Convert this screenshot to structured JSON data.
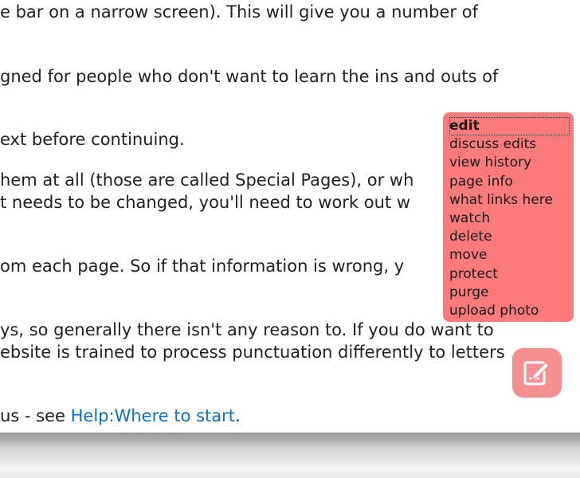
{
  "article": {
    "lines": [
      "e bar on a narrow screen). This will give you a number of",
      "gned for people who don't want to learn the ins and outs of",
      "ext before continuing.",
      "hem at all (those are called Special Pages), or wh",
      "t needs to be changed, you'll need to work out w",
      "om each page. So if that information is wrong, y",
      "ys, so generally there isn't any reason to. If you do want to",
      "ebsite is trained to process punctuation differently to letters",
      "us - see "
    ],
    "link_text": "Help:Where to start",
    "after_link": "."
  },
  "menu": {
    "items": [
      "edit",
      "discuss edits",
      "view history",
      "page info",
      "what links here",
      "watch",
      "delete",
      "move",
      "protect",
      "purge",
      "upload photo"
    ]
  },
  "edit_button": {
    "icon": "edit-pencil-icon",
    "color": "#f68f8f"
  },
  "colors": {
    "menu_background": "#fb7a7a",
    "link": "#0b6fc6"
  }
}
